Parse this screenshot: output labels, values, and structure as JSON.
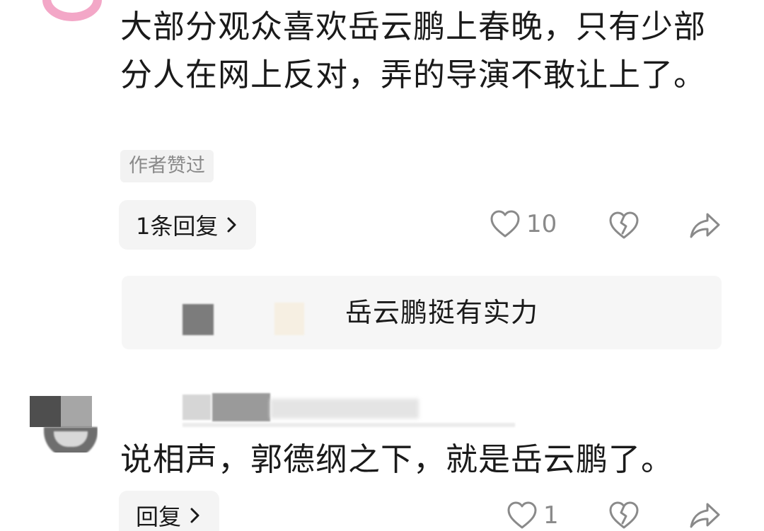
{
  "comment1": {
    "text": "大部分观众喜欢岳云鹏上春晚，只有少部分人在网上反对，弄的导演不敢让上了。",
    "author_badge": "作者赞过",
    "reply_label": "1条回复",
    "like_count": "10"
  },
  "subreply": {
    "text": "岳云鹏挺有实力"
  },
  "comment2": {
    "text": "说相声，郭德纲之下，就是岳云鹏了。",
    "reply_label": "回复",
    "like_count": "1"
  },
  "icons": {
    "like": "heart-outline-icon",
    "dislike": "broken-heart-icon",
    "share": "share-arrow-icon",
    "expand": "chevron-right-icon"
  },
  "colors": {
    "text": "#1a1a1a",
    "muted": "#8a8a8a",
    "pill_bg": "#f4f4f4",
    "avatar_pink": "#f3a7c7"
  }
}
